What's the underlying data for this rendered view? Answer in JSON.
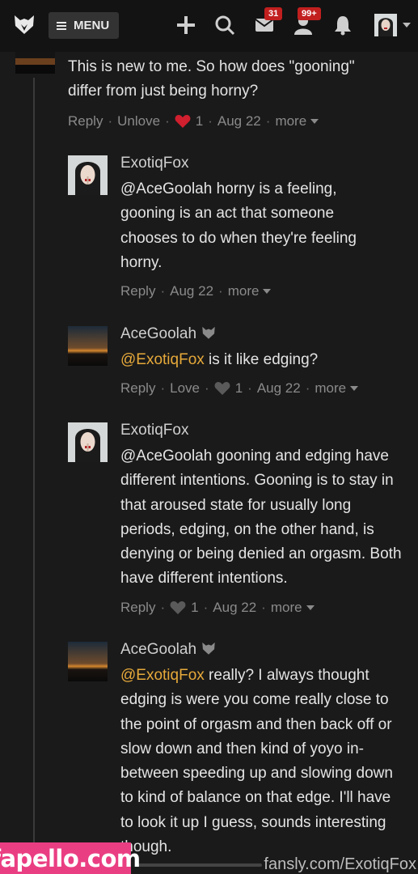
{
  "header": {
    "menu_label": "MENU",
    "messages_badge": "31",
    "notifications_badge": "99+"
  },
  "comments": [
    {
      "text": "This is new to me. So how does \"gooning\" differ from just being horny?",
      "actions": {
        "reply": "Reply",
        "like": "Unlove",
        "count": "1",
        "date": "Aug 22",
        "more": "more"
      }
    },
    {
      "author": "ExotiqFox",
      "mention": "@AceGoolah",
      "text": " horny is a feeling, gooning is an act that someone chooses to do when they're feeling horny.",
      "actions": {
        "reply": "Reply",
        "date": "Aug 22",
        "more": "more"
      }
    },
    {
      "author": "AceGoolah",
      "mention": "@ExotiqFox",
      "text": " is it like edging?",
      "actions": {
        "reply": "Reply",
        "like": "Love",
        "count": "1",
        "date": "Aug 22",
        "more": "more"
      }
    },
    {
      "author": "ExotiqFox",
      "mention": "@AceGoolah",
      "text": " gooning and edging have different intentions. Gooning is to stay in that aroused state for usually long periods, edging, on the other hand, is denying or being denied an orgasm. Both have different intentions.",
      "actions": {
        "reply": "Reply",
        "count": "1",
        "date": "Aug 22",
        "more": "more"
      }
    },
    {
      "author": "AceGoolah",
      "mention": "@ExotiqFox",
      "text": " really? I always thought edging is were you come really close to the point of orgasm and then back off or slow down and then kind of yoyo in-between speeding up and slowing down to kind of balance on that edge. I'll have to look it up I guess, sounds interesting though."
    }
  ],
  "watermarks": {
    "left": "fapello.com",
    "right": "fansly.com/ExotiqFox"
  },
  "colors": {
    "mention": "#e6a93a",
    "badge": "#c21f1f",
    "heart_liked": "#d01f2e",
    "watermark_bg": "#ea3e83"
  }
}
